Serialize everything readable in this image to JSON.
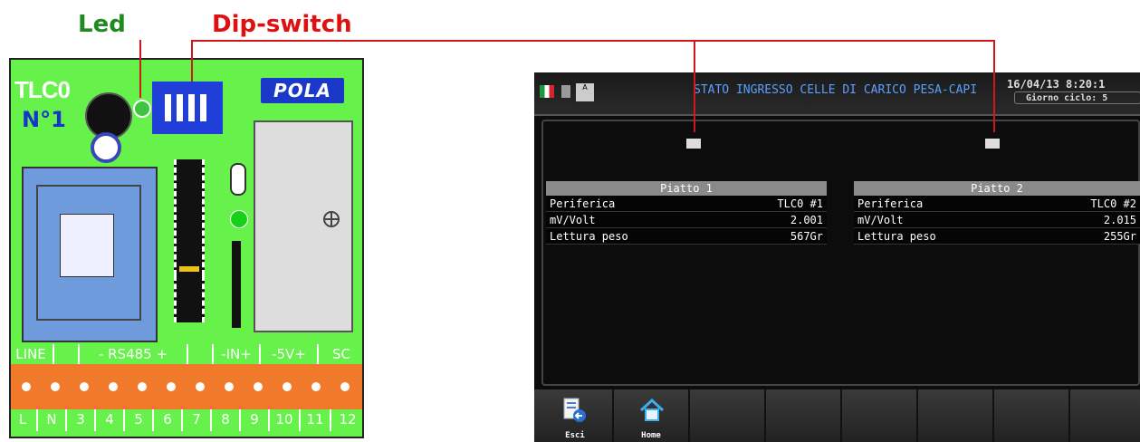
{
  "labels": {
    "led": "Led",
    "dip_switch": "Dip-switch"
  },
  "board": {
    "id": "TLC0",
    "number": "N°1",
    "brand": "POLA",
    "buzzer_text": "",
    "terminal_top": [
      "LINE",
      "",
      "- RS485 +",
      "",
      "-IN+",
      "-5V+",
      "SC"
    ],
    "terminal_bottom": [
      "L",
      "N",
      "3",
      "4",
      "5",
      "6",
      "7",
      "8",
      "9",
      "10",
      "11",
      "12"
    ]
  },
  "hmi": {
    "title": "STATO INGRESSO CELLE DI CARICO PESA-CAPI",
    "datetime": "16/04/13  8:20:1",
    "ciclo": "Giorno ciclo: 5",
    "plates": [
      {
        "header": "Piatto 1",
        "rows": [
          {
            "label": "Periferica",
            "value": "TLC0 #1"
          },
          {
            "label": "mV/Volt",
            "value": "2.001"
          },
          {
            "label": "Lettura peso",
            "value": "567Gr"
          }
        ]
      },
      {
        "header": "Piatto 2",
        "rows": [
          {
            "label": "Periferica",
            "value": "TLC0 #2"
          },
          {
            "label": "mV/Volt",
            "value": "2.015"
          },
          {
            "label": "Lettura peso",
            "value": "255Gr"
          }
        ]
      }
    ],
    "footer": {
      "esci": "Esci",
      "home": "Home"
    }
  },
  "colors": {
    "board": "#66f24a",
    "callout_line": "#d01818",
    "led_label": "#1f8a1f",
    "dip_label": "#e01010"
  }
}
